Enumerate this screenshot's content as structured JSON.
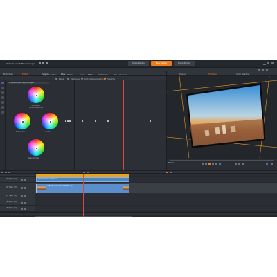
{
  "app": {
    "menu": [
      "Datei",
      "Bearbeiten",
      "Einstellungen"
    ],
    "mode_tabs": [
      {
        "label": "Importieren",
        "active": false
      },
      {
        "label": "Bearbeiten",
        "active": true
      },
      {
        "label": "Exportieren",
        "active": false
      }
    ]
  },
  "editor_tabs": [
    "Bibliothek",
    "Effekt",
    "Filmkits",
    "Titel"
  ],
  "effect_tabs": [
    "Eigenschaften",
    "Media Editor",
    "Farbe",
    "Effekt",
    "360-Video",
    "Pan und Zoom"
  ],
  "sub_toolbar": [
    "Basis",
    "Farbkurve",
    "LUT-Dateiverwaltung",
    "Selektiv"
  ],
  "color_panel": {
    "preset_label": "Professionelle Anpassungen",
    "wheels": [
      {
        "name": "Tiefen",
        "label": "Tiefen"
      },
      {
        "name": "Kräftigkeit",
        "label": "Einstellen\nFarbtonbalance"
      },
      {
        "name": "Mitteltöne",
        "label": "Mitteltöne"
      },
      {
        "name": "Lichter",
        "label": "Lichter"
      },
      {
        "name": "Glanzlichter",
        "label": "Glanzlichter"
      }
    ]
  },
  "preview": {
    "tabs": [
      "Quelle",
      "Timeline",
      "Color Grading"
    ],
    "active_tab": "Timeline",
    "mode_label": "Frame"
  },
  "timeline": {
    "track_names": [
      "A/V Spur (1)",
      "A/V Spur (2)",
      "A/V Spur (3)",
      "A/V Spur (4)",
      "A/V Spur (5)"
    ],
    "clip_title_label": "Lizenz Version 4.0/Kenn",
    "clip_video_label": "Luftaufnahme Strand 1080p.mp4"
  },
  "colors": {
    "accent_orange": "#f07a1a",
    "clip_yellow": "#e9a319",
    "clip_blue": "#4e85c4",
    "panel_bg": "#2b2e34"
  }
}
